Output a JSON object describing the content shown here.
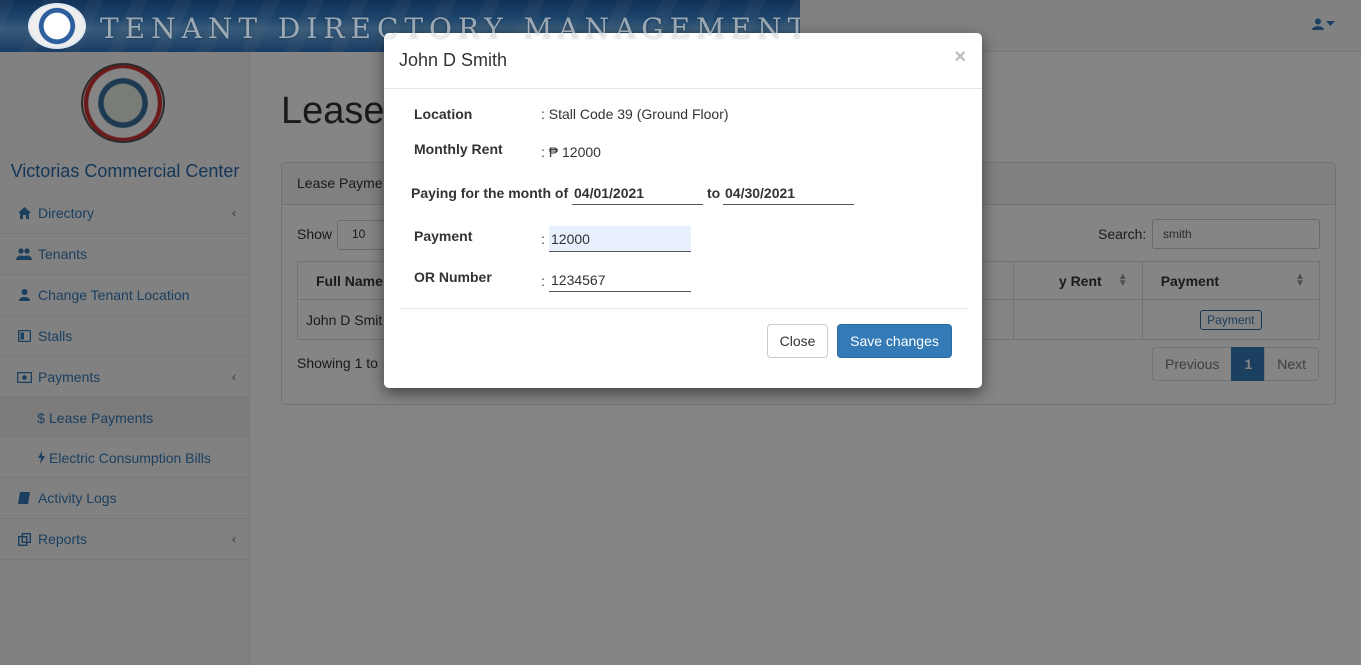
{
  "header": {
    "banner_title": "TENANT DIRECTORY MANAGEMENT"
  },
  "sidebar": {
    "center_name": "Victorias Commercial Center",
    "items": [
      {
        "label": "Directory",
        "icon": "home-icon"
      },
      {
        "label": "Tenants",
        "icon": "users-icon"
      },
      {
        "label": "Change Tenant Location",
        "icon": "user-icon"
      },
      {
        "label": "Stalls",
        "icon": "book-open-icon"
      },
      {
        "label": "Payments",
        "icon": "money-icon"
      },
      {
        "label": "Lease Payments",
        "icon": "dollar-icon"
      },
      {
        "label": "Electric Consumption Bills",
        "icon": "bolt-icon"
      },
      {
        "label": "Activity Logs",
        "icon": "book-icon"
      },
      {
        "label": "Reports",
        "icon": "copy-icon"
      }
    ]
  },
  "main": {
    "page_title": "Lease",
    "panel_heading": "Lease Payme",
    "show_label": "Show",
    "show_value": "10",
    "search_label": "Search:",
    "search_value": "smith",
    "table": {
      "headers": [
        "Full Name",
        "y Rent",
        "Payment"
      ],
      "rows": [
        {
          "full_name": "John D Smit",
          "action": "Payment"
        }
      ]
    },
    "showing_text": "Showing 1 to",
    "pager": {
      "prev": "Previous",
      "page": "1",
      "next": "Next"
    }
  },
  "modal": {
    "title": "John D Smith",
    "close_symbol": "×",
    "location_label": "Location",
    "location_value": ": Stall Code 39 (Ground Floor)",
    "rent_label": "Monthly Rent",
    "rent_value": ": ₱ 12000",
    "paying_label": "Paying for the month of",
    "date_from": "04/01/2021",
    "to_label": "to",
    "date_to": "04/30/2021",
    "payment_label": "Payment",
    "payment_value": "12000",
    "or_label": "OR Number",
    "or_value": "1234567",
    "colon": ":",
    "close_button": "Close",
    "save_button": "Save changes"
  }
}
